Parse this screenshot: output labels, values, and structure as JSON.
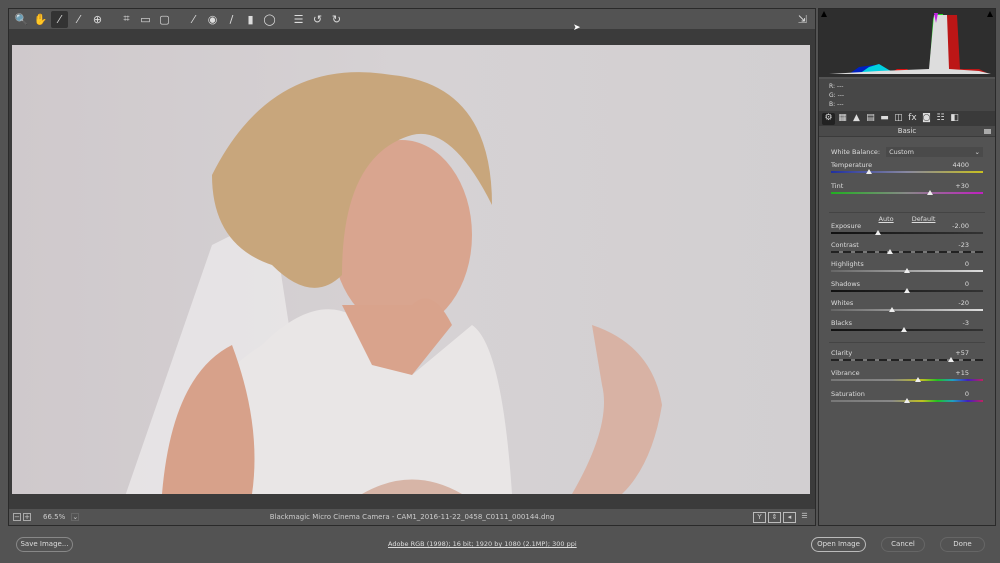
{
  "toolbar": {
    "tools": [
      {
        "name": "zoom-tool-icon",
        "glyph": "🔍"
      },
      {
        "name": "hand-tool-icon",
        "glyph": "✋"
      },
      {
        "name": "white-balance-tool-icon",
        "glyph": "⁄"
      },
      {
        "name": "color-sampler-tool-icon",
        "glyph": "⁄"
      },
      {
        "name": "targeted-adjustment-tool-icon",
        "glyph": "⊕"
      },
      {
        "name": "crop-tool-icon",
        "glyph": "⌗"
      },
      {
        "name": "straighten-tool-icon",
        "glyph": "▭"
      },
      {
        "name": "transform-tool-icon",
        "glyph": "▢"
      },
      {
        "name": "spot-removal-tool-icon",
        "glyph": "⁄"
      },
      {
        "name": "red-eye-tool-icon",
        "glyph": "◉"
      },
      {
        "name": "adjustment-brush-icon",
        "glyph": "/"
      },
      {
        "name": "graduated-filter-icon",
        "glyph": "▮"
      },
      {
        "name": "radial-filter-icon",
        "glyph": "◯"
      },
      {
        "name": "preferences-icon",
        "glyph": "☰"
      },
      {
        "name": "rotate-left-icon",
        "glyph": "↺"
      },
      {
        "name": "rotate-right-icon",
        "glyph": "↻"
      }
    ],
    "expand_icon": "⇲"
  },
  "status": {
    "zoom": "66.5%",
    "filename": "Blackmagic Micro Cinema Camera  -  CAM1_2016-11-22_0458_C0111_000144.dng",
    "view_buttons": [
      "Y",
      "⇕",
      "◂",
      "☰"
    ]
  },
  "histogram": {
    "r": "R:   ---",
    "g": "G:   ---",
    "b": "B:   ---"
  },
  "panel": {
    "tabs": [
      "⚙",
      "▦",
      "▲",
      "▤",
      "▬",
      "◫",
      "fx",
      "◙",
      "☷",
      "◧"
    ],
    "title": "Basic",
    "white_balance_label": "White Balance:",
    "white_balance_value": "Custom",
    "auto": "Auto",
    "default": "Default",
    "sliders": [
      {
        "label": "Temperature",
        "value": "4400",
        "level": 0.25,
        "track": "temp"
      },
      {
        "label": "Tint",
        "value": "+30",
        "level": 0.65,
        "track": "tint"
      },
      {
        "label": "Exposure",
        "value": "-2.00",
        "level": 0.31,
        "track": "dark"
      },
      {
        "label": "Contrast",
        "value": "-23",
        "level": 0.39,
        "track": "dash"
      },
      {
        "label": "Highlights",
        "value": "0",
        "level": 0.5,
        "track": "light"
      },
      {
        "label": "Shadows",
        "value": "0",
        "level": 0.5,
        "track": "dark"
      },
      {
        "label": "Whites",
        "value": "-20",
        "level": 0.4,
        "track": "light"
      },
      {
        "label": "Blacks",
        "value": "-3",
        "level": 0.48,
        "track": "dark"
      },
      {
        "label": "Clarity",
        "value": "+57",
        "level": 0.79,
        "track": "dash"
      },
      {
        "label": "Vibrance",
        "value": "+15",
        "level": 0.57,
        "track": "rainbow"
      },
      {
        "label": "Saturation",
        "value": "0",
        "level": 0.5,
        "track": "rainbow"
      }
    ]
  },
  "footer": {
    "save": "Save Image...",
    "info": "Adobe RGB (1998); 16 bit; 1920 by 1080 (2.1MP); 300 ppi",
    "open": "Open Image",
    "cancel": "Cancel",
    "done": "Done"
  }
}
